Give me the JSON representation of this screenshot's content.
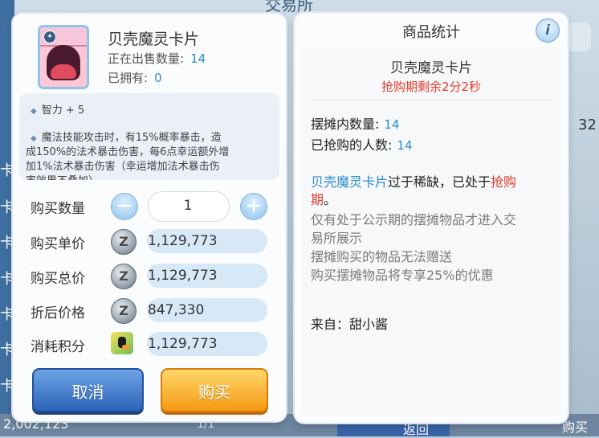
{
  "background": {
    "title": "交易所",
    "side_items": [
      "卡",
      "卡",
      "卡",
      "卡",
      "卡",
      "卡",
      "卡",
      "卡"
    ],
    "right_number": "32",
    "bottom_price": "2,002,123",
    "bottom_page": "1/1",
    "bottom_button": "返回",
    "bottom_right": "购买"
  },
  "item": {
    "name": "贝壳魔灵卡片",
    "on_sale_label": "正在出售数量:",
    "on_sale_count": "14",
    "owned_label": "已拥有:",
    "owned_count": "0",
    "desc_bullet1": "智力 + 5",
    "desc_bullet2_l1": "魔法技能攻击时，有15%概率暴击，造",
    "desc_bullet2_l2": "成150%的法术暴击伤害，每6点幸运额外增",
    "desc_bullet2_l3": "加1%法术暴击伤害（幸运增加法术暴击伤",
    "desc_bullet2_l4": "害效果不叠加）"
  },
  "purchase": {
    "qty_label": "购买数量",
    "qty_value": "1",
    "unit_price_label": "购买单价",
    "unit_price": "1,129,773",
    "total_label": "购买总价",
    "total": "1,129,773",
    "discount_label": "折后价格",
    "discount_price": "847,330",
    "points_label": "消耗积分",
    "points": "1,129,773",
    "cancel_label": "取消",
    "buy_label": "购买",
    "zeny_symbol": "Z",
    "minus_symbol": "−",
    "plus_symbol": "+"
  },
  "stats": {
    "title": "商品统计",
    "info_symbol": "i",
    "item_name": "贝壳魔灵卡片",
    "countdown": "抢购期剩余2分2秒",
    "booth_label": "摆摊内数量:",
    "booth_count": "14",
    "bought_label": "已抢购的人数:",
    "bought_count": "14",
    "notice_item": "贝壳魔灵卡片",
    "notice_mid": "过于稀缺，已处于",
    "notice_red1": "抢购",
    "notice_red2": "期",
    "notice_end": "。",
    "gray1a": "仅有处于公示期的摆摊物品才进入交",
    "gray1b": "易所展示",
    "gray2": "摆摊购买的物品无法赠送",
    "gray3": "购买摆摊物品将专享25%的优惠",
    "from": "来自：甜小酱"
  },
  "colors": {
    "accent_blue": "#2e8bc9",
    "alert_red": "#e4392b",
    "cancel_button": "#2c64b9",
    "buy_button": "#f59a14"
  }
}
